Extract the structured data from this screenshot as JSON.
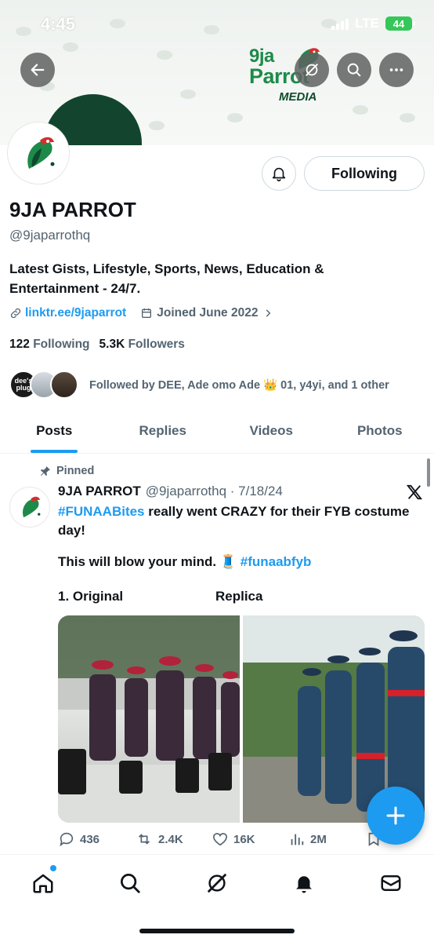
{
  "status_bar": {
    "time": "4:45",
    "network": "LTE",
    "battery": "44"
  },
  "banner": {
    "brand_line1": "9ja",
    "brand_line2": "Parrot",
    "brand_line3": "MEDIA"
  },
  "profile": {
    "display_name": "9JA PARROT",
    "handle": "@9japarrothq",
    "following_button": "Following",
    "bio": "Latest Gists, Lifestyle, Sports, News, Education & Entertainment - 24/7.",
    "link": "linktr.ee/9japarrot",
    "joined": "Joined June 2022",
    "following_count": "122",
    "following_label": "Following",
    "followers_count": "5.3K",
    "followers_label": "Followers",
    "followed_by": "Followed by DEE, Ade omo Ade 👑 01, y4yi, and 1 other",
    "followed_avatar_1_text": "dee's plug"
  },
  "tabs": [
    {
      "label": "Posts",
      "active": true
    },
    {
      "label": "Replies",
      "active": false
    },
    {
      "label": "Videos",
      "active": false
    },
    {
      "label": "Photos",
      "active": false
    }
  ],
  "tweet": {
    "pinned_label": "Pinned",
    "author": "9JA PARROT",
    "handle_date": "@9japarrothq · 7/18/24",
    "hashtag1": "#FUNAABites",
    "text1": " really went CRAZY for their FYB costume day!",
    "text2": "This will blow your mind. 🧵 ",
    "hashtag2": "#funaabfyb",
    "label_left": "1.   Original",
    "label_right": "Replica",
    "replies": "436",
    "reposts": "2.4K",
    "likes": "16K",
    "views": "2M"
  },
  "colors": {
    "accent": "#1d9bf0",
    "brand_green": "#1e8a4a",
    "banner_dark": "#13452e"
  }
}
